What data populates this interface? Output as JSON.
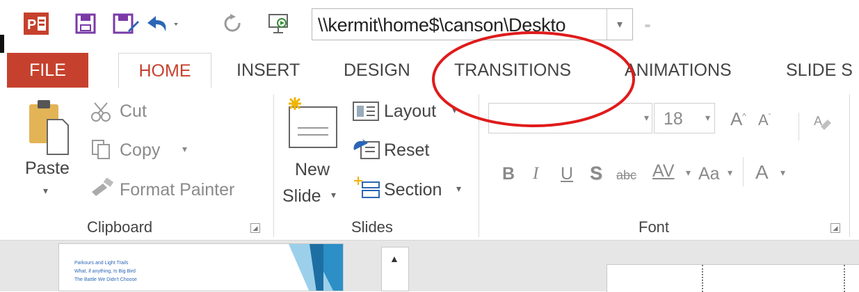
{
  "qat": {
    "path": "\\\\kermit\\home$\\canson\\Deskto",
    "icons": [
      "powerpoint-logo-icon",
      "save-icon",
      "save-as-icon",
      "undo-icon",
      "redo-icon",
      "from-beginning-icon"
    ]
  },
  "tabs": [
    "FILE",
    "HOME",
    "INSERT",
    "DESIGN",
    "TRANSITIONS",
    "ANIMATIONS",
    "SLIDE S"
  ],
  "clipboard": {
    "paste": "Paste",
    "cut": "Cut",
    "copy": "Copy",
    "format_painter": "Format Painter",
    "group": "Clipboard"
  },
  "slides": {
    "new": "New",
    "slide": "Slide",
    "layout": "Layout",
    "reset": "Reset",
    "section": "Section",
    "group": "Slides"
  },
  "font": {
    "size": "18",
    "bold": "B",
    "italic": "I",
    "underline": "U",
    "shadow": "S",
    "strike": "abc",
    "spacing": "AV",
    "case": "Aa",
    "color": "A",
    "group": "Font"
  },
  "thumbnail_lines": [
    "Parkours and Light Trails",
    "What, if anything, Is Big Bird",
    "The Battle We Didn't Choose"
  ],
  "colors": {
    "accent": "#c6412d",
    "annotation": "#e01b1b"
  }
}
